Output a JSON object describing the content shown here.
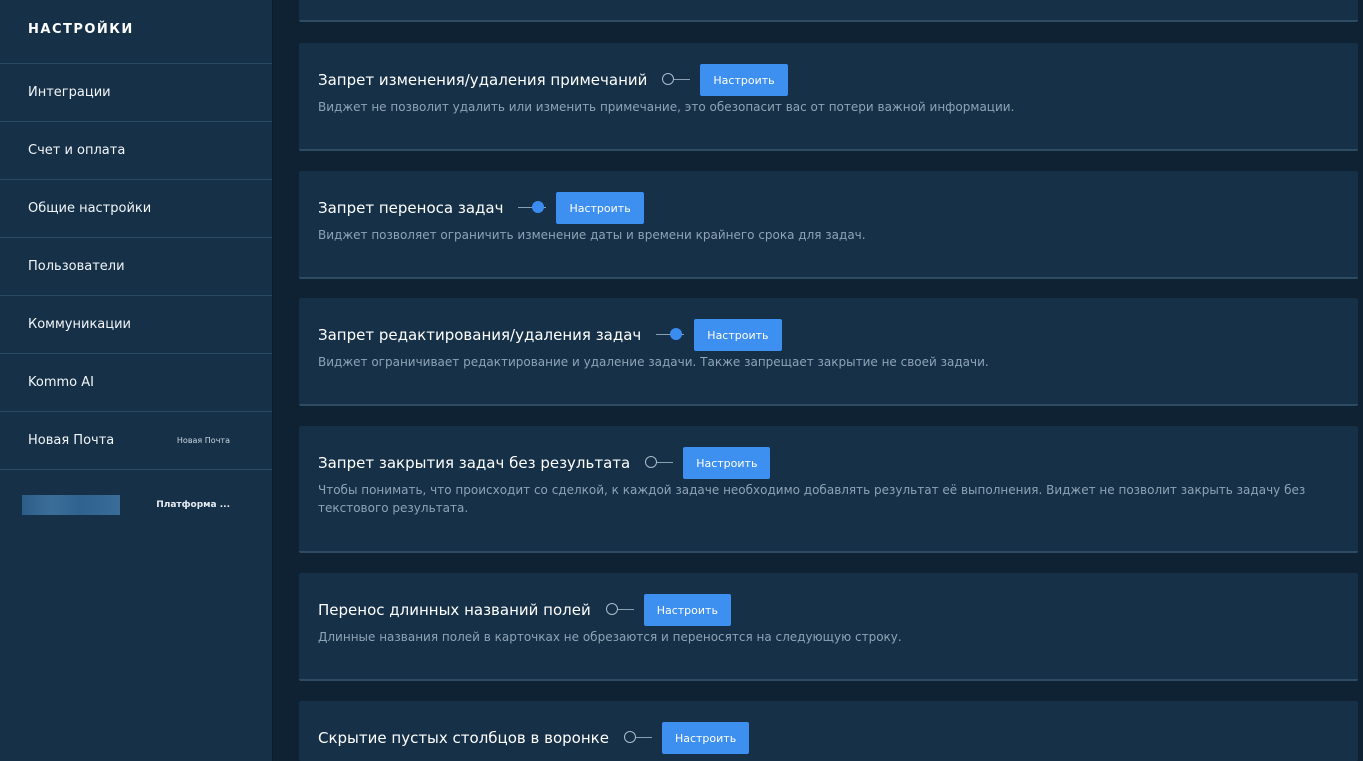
{
  "sidebar": {
    "title": "НАСТРОЙКИ",
    "items": [
      {
        "label": "Интеграции"
      },
      {
        "label": "Счет и оплата"
      },
      {
        "label": "Общие настройки"
      },
      {
        "label": "Пользователи"
      },
      {
        "label": "Коммуникации"
      },
      {
        "label": "Kommo AI"
      },
      {
        "label": "Новая Почта",
        "sublabel": "Новая Почта"
      }
    ],
    "widget": {
      "name": "Платформа ..."
    }
  },
  "widgets": [
    {
      "title": "Запрет изменения/удаления примечаний",
      "enabled": false,
      "button": "Настроить",
      "description": "Виджет не позволит удалить или изменить примечание, это обезопасит вас от потери важной информации."
    },
    {
      "title": "Запрет переноса задач",
      "enabled": true,
      "button": "Настроить",
      "description": "Виджет позволяет ограничить изменение даты и времени крайнего срока для задач."
    },
    {
      "title": "Запрет редактирования/удаления задач",
      "enabled": true,
      "button": "Настроить",
      "description": "Виджет ограничивает редактирование и удаление задачи. Также запрещает закрытие не своей задачи."
    },
    {
      "title": "Запрет закрытия задач без результата",
      "enabled": false,
      "button": "Настроить",
      "description": "Чтобы понимать, что происходит со сделкой, к каждой задаче необходимо добавлять результат её выполнения. Виджет не позволит закрыть задачу без текстового результата."
    },
    {
      "title": "Перенос длинных названий полей",
      "enabled": false,
      "button": "Настроить",
      "description": "Длинные названия полей в карточках не обрезаются и переносятся на следующую строку."
    },
    {
      "title": "Скрытие пустых столбцов в воронке",
      "enabled": false,
      "button": "Настроить",
      "description": ""
    }
  ]
}
